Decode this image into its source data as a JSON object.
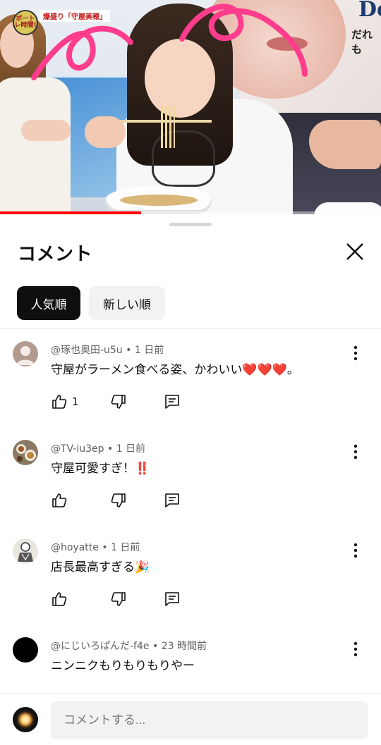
{
  "video": {
    "show_logo_text": "ボートレ時間!",
    "banner_text": "爆盛り「守屋美穂」",
    "poster_text_1": "De",
    "poster_text_2": "だれも",
    "progress_fraction": 0.37,
    "progress_color": "#ff0000",
    "annotation_color": "#ff3d8c"
  },
  "sheet": {
    "title": "コメント",
    "close_icon": "close-icon",
    "sort_chips": [
      {
        "label": "人気順",
        "active": true
      },
      {
        "label": "新しい順",
        "active": false
      }
    ]
  },
  "comments": [
    {
      "author": "@琢也奥田-u5u",
      "time": "1 日前",
      "text": "守屋がラーメン食べる姿、かわいい",
      "emoji": "❤️❤️❤️",
      "trail": "。",
      "likes": "1",
      "avatar": "person-silhouette"
    },
    {
      "author": "@TV-iu3ep",
      "time": "1 日前",
      "text": "守屋可愛すぎ！",
      "emoji": "‼️",
      "trail": "",
      "likes": "",
      "avatar": "food-photo"
    },
    {
      "author": "@hoyatte",
      "time": "1 日前",
      "text": "店長最高すぎる",
      "emoji": "🎉",
      "trail": "",
      "likes": "",
      "avatar": "illustration"
    },
    {
      "author": "@にじいろぱんだ-f4e",
      "time": "23 時間前",
      "text": "ニンニクもりもりもりやー",
      "emoji": "",
      "trail": "",
      "likes": "",
      "avatar": "black-circle"
    }
  ],
  "composer": {
    "placeholder": "コメントする..."
  }
}
